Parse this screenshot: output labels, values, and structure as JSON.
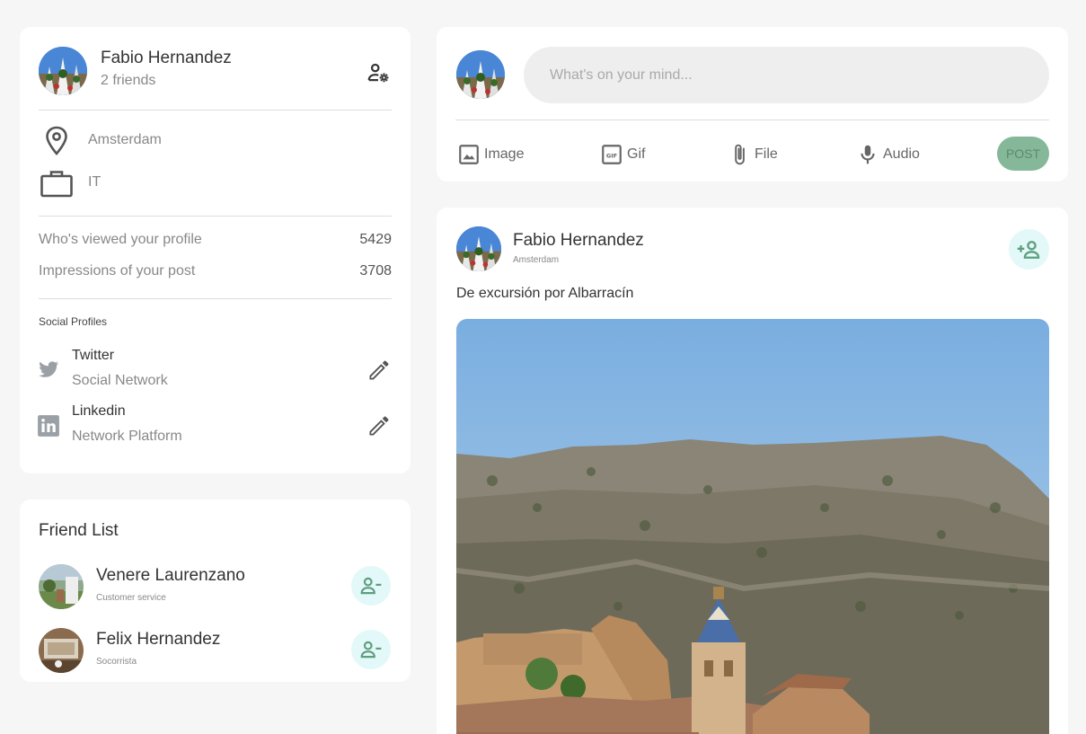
{
  "profile": {
    "name": "Fabio Hernandez",
    "friends": "2 friends",
    "location": "Amsterdam",
    "occupation": "IT",
    "stats": [
      {
        "label": "Who's viewed your profile",
        "value": "5429"
      },
      {
        "label": "Impressions of your post",
        "value": "3708"
      }
    ],
    "social_title": "Social Profiles",
    "socials": [
      {
        "name": "Twitter",
        "type": "Social Network",
        "icon": "twitter-icon"
      },
      {
        "name": "Linkedin",
        "type": "Network Platform",
        "icon": "linkedin-icon"
      }
    ]
  },
  "friend_list": {
    "title": "Friend List",
    "friends": [
      {
        "name": "Venere Laurenzano",
        "role": "Customer service"
      },
      {
        "name": "Felix Hernandez",
        "role": "Socorrista"
      }
    ]
  },
  "composer": {
    "placeholder": "What's on your mind...",
    "attachments": [
      {
        "label": "Image",
        "icon": "image-icon"
      },
      {
        "label": "Gif",
        "icon": "gif-icon"
      },
      {
        "label": "File",
        "icon": "paperclip-icon"
      },
      {
        "label": "Audio",
        "icon": "microphone-icon"
      }
    ],
    "post_label": "POST"
  },
  "post": {
    "author": "Fabio Hernandez",
    "location": "Amsterdam",
    "caption": "De excursión por Albarracín"
  },
  "colors": {
    "accent": "#85b899",
    "icon_bubble": "#e3f8f8",
    "icon_green": "#5e9e7e",
    "page_bg": "#f6f6f6"
  }
}
